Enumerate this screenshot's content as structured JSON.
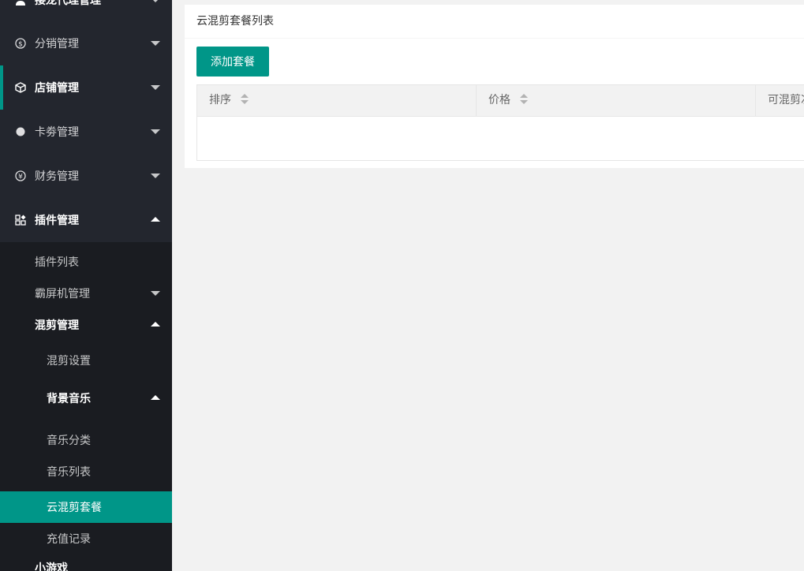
{
  "sidebar": {
    "items": [
      {
        "label": "接龙代理管理",
        "icon": "user-icon"
      },
      {
        "label": "分销管理",
        "icon": "dollar-circle-icon"
      },
      {
        "label": "店铺管理",
        "icon": "cube-icon"
      },
      {
        "label": "卡劵管理",
        "icon": "dot-circle-icon"
      },
      {
        "label": "财务管理",
        "icon": "yen-circle-icon"
      },
      {
        "label": "插件管理",
        "icon": "apps-icon"
      },
      {
        "label": "小游戏"
      }
    ],
    "children": {
      "plugin_list": "插件列表",
      "screen_machine": "霸屏机管理",
      "mix_cut": "混剪管理",
      "mix_cut_settings": "混剪设置",
      "bg_music": "背景音乐",
      "music_category": "音乐分类",
      "music_list": "音乐列表",
      "cloud_package": "云混剪套餐",
      "recharge_record": "充值记录"
    },
    "accent": "#009688",
    "background": "#23262e"
  },
  "main": {
    "card_title": "云混剪套餐列表",
    "add_button": "添加套餐",
    "table": {
      "columns": [
        "排序",
        "价格",
        "可混剪次数"
      ],
      "rows": []
    }
  }
}
